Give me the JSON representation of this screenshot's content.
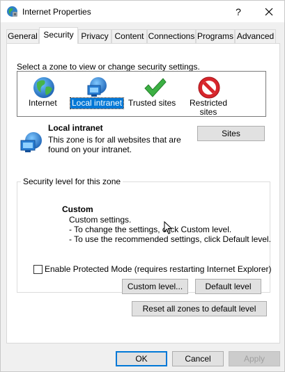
{
  "window": {
    "title": "Internet Properties",
    "help": "?",
    "close_icon": "close-icon"
  },
  "tabs": [
    {
      "label": "General"
    },
    {
      "label": "Security"
    },
    {
      "label": "Privacy"
    },
    {
      "label": "Content"
    },
    {
      "label": "Connections"
    },
    {
      "label": "Programs"
    },
    {
      "label": "Advanced"
    }
  ],
  "active_tab": "Security",
  "security": {
    "zone_hint": "Select a zone to view or change security settings.",
    "zones": [
      {
        "label": "Internet",
        "icon": "globe-icon"
      },
      {
        "label": "Local intranet",
        "icon": "intranet-globe-icon"
      },
      {
        "label": "Trusted sites",
        "icon": "checkmark-icon"
      },
      {
        "label": "Restricted sites",
        "label_line1": "Restricted",
        "label_line2": "sites",
        "icon": "no-entry-icon"
      }
    ],
    "selected_zone": "Local intranet",
    "info": {
      "title": "Local intranet",
      "desc_line1": "This zone is for all websites that are",
      "desc_line2": "found on your intranet."
    },
    "sites_button": "Sites",
    "level_group_title": "Security level for this zone",
    "level": {
      "title": "Custom",
      "line1": "Custom settings.",
      "line2": "- To change the settings, click Custom level.",
      "line3": "- To use the recommended settings, click Default level."
    },
    "protected_mode_label": "Enable Protected Mode (requires restarting Internet Explorer)",
    "protected_mode_checked": false,
    "custom_level_button": "Custom level...",
    "default_level_button": "Default level",
    "reset_button": "Reset all zones to default level"
  },
  "footer": {
    "ok": "OK",
    "cancel": "Cancel",
    "apply": "Apply"
  },
  "colors": {
    "selection": "#0078d7",
    "window_bg": "#f0f0f0",
    "panel_bg": "#ffffff"
  }
}
